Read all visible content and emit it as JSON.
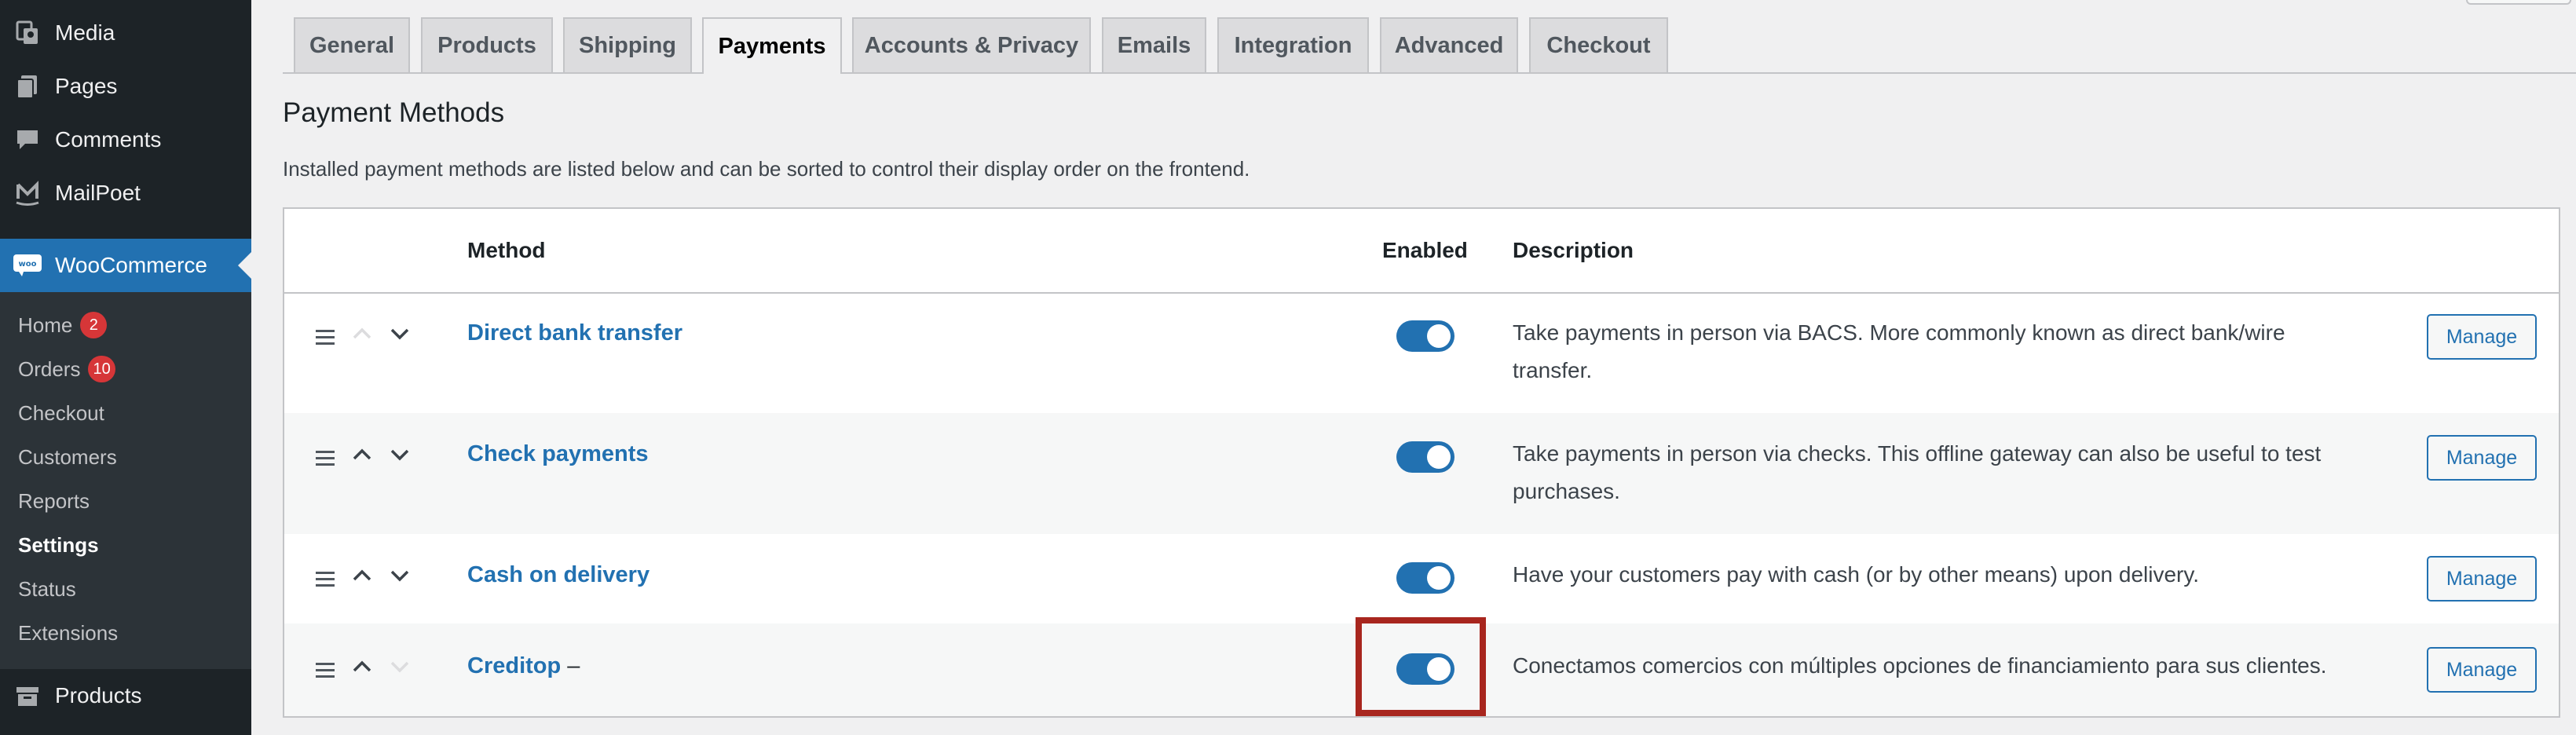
{
  "sidebar": {
    "menu": [
      {
        "label": "Media",
        "icon": "media-icon"
      },
      {
        "label": "Pages",
        "icon": "pages-icon"
      },
      {
        "label": "Comments",
        "icon": "comments-icon"
      },
      {
        "label": "MailPoet",
        "icon": "mailpoet-icon"
      }
    ],
    "woocommerce": {
      "label": "WooCommerce",
      "icon": "woocommerce-icon",
      "icon_text": "woo"
    },
    "submenu": [
      {
        "label": "Home",
        "badge": "2"
      },
      {
        "label": "Orders",
        "badge": "10"
      },
      {
        "label": "Checkout"
      },
      {
        "label": "Customers"
      },
      {
        "label": "Reports"
      },
      {
        "label": "Settings",
        "current": true
      },
      {
        "label": "Status"
      },
      {
        "label": "Extensions"
      }
    ],
    "products": {
      "label": "Products",
      "icon": "products-icon"
    }
  },
  "tabs": [
    {
      "label": "General"
    },
    {
      "label": "Products"
    },
    {
      "label": "Shipping"
    },
    {
      "label": "Payments",
      "active": true
    },
    {
      "label": "Accounts & Privacy"
    },
    {
      "label": "Emails"
    },
    {
      "label": "Integration"
    },
    {
      "label": "Advanced"
    },
    {
      "label": "Checkout"
    }
  ],
  "section": {
    "title": "Payment Methods",
    "description": "Installed payment methods are listed below and can be sorted to control their display order on the frontend."
  },
  "table": {
    "headers": {
      "method": "Method",
      "enabled": "Enabled",
      "description": "Description"
    },
    "rows": [
      {
        "name": "Direct bank transfer",
        "suffix": "",
        "enabled": true,
        "description": "Take payments in person via BACS. More commonly known as direct bank/wire transfer.",
        "manage_label": "Manage",
        "up_disabled": true,
        "down_disabled": false
      },
      {
        "name": "Check payments",
        "suffix": "",
        "enabled": true,
        "description": "Take payments in person via checks. This offline gateway can also be useful to test purchases.",
        "manage_label": "Manage",
        "up_disabled": false,
        "down_disabled": false
      },
      {
        "name": "Cash on delivery",
        "suffix": "",
        "enabled": true,
        "description": "Have your customers pay with cash (or by other means) upon delivery.",
        "manage_label": "Manage",
        "up_disabled": false,
        "down_disabled": false
      },
      {
        "name": "Creditop",
        "suffix": "–",
        "enabled": true,
        "description": "Conectamos comercios con múltiples opciones de financiamiento para sus clientes.",
        "manage_label": "Manage",
        "up_disabled": false,
        "down_disabled": true
      }
    ]
  },
  "colors": {
    "accent": "#2271b1",
    "sidebar_bg": "#1d2327",
    "submenu_bg": "#2c3338",
    "badge": "#d63638",
    "highlight": "#a8261e"
  }
}
